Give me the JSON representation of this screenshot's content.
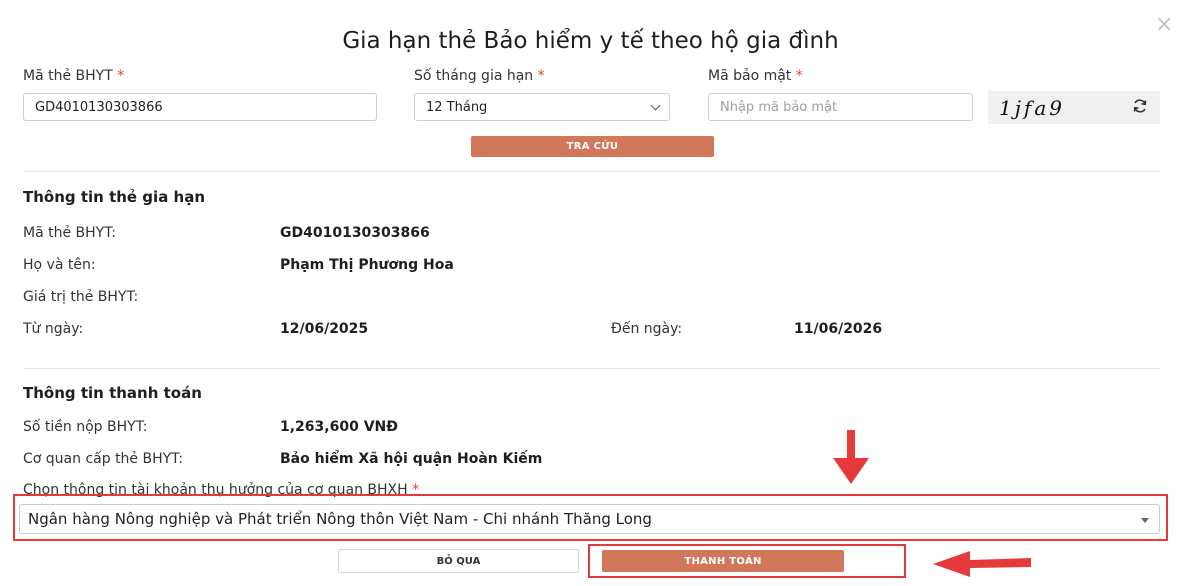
{
  "dialog": {
    "title": "Gia hạn thẻ Bảo hiểm y tế theo hộ gia đình",
    "close_glyph": "×"
  },
  "form": {
    "card_label": "Mã thẻ BHYT",
    "card_value": "GD4010130303866",
    "months_label": "Số tháng gia hạn",
    "months_value": "12 Tháng",
    "security_label": "Mã bảo mật",
    "security_placeholder": "Nhập mã bảo mật",
    "captcha_text": "1jfa9",
    "required_mark": "*",
    "lookup_button": "TRA CỨU"
  },
  "card_info": {
    "section_title": "Thông tin thẻ gia hạn",
    "card_label": "Mã thẻ BHYT:",
    "card_value": "GD4010130303866",
    "name_label": "Họ và tên:",
    "name_value": "Phạm Thị Phương Hoa",
    "validity_label": "Giá trị thẻ BHYT:",
    "from_label": "Từ ngày:",
    "from_value": "12/06/2025",
    "to_label": "Đến ngày:",
    "to_value": "11/06/2026"
  },
  "payment": {
    "section_title": "Thông tin thanh toán",
    "amount_label": "Số tiền nộp BHYT:",
    "amount_value": "1,263,600 VNĐ",
    "agency_label": "Cơ quan cấp thẻ BHYT:",
    "agency_value": "Bảo hiểm Xã hội quận Hoàn Kiếm",
    "beneficiary_label": "Chọn thông tin tài khoản thụ hưởng của cơ quan BHXH",
    "beneficiary_value": "Ngân hàng Nông nghiệp và Phát triển Nông thôn Việt Nam - Chi nhánh Thăng Long"
  },
  "actions": {
    "skip_button": "BỎ QUA",
    "pay_button": "THANH TOÁN"
  },
  "colors": {
    "primary": "#d1775a",
    "annotation_red": "#e5393b",
    "required": "#e43b3b"
  },
  "icons": [
    "close-icon",
    "chevron-down-icon",
    "refresh-icon",
    "dropdown-triangle-icon",
    "annotation-arrow-down-icon",
    "annotation-arrow-left-icon"
  ]
}
